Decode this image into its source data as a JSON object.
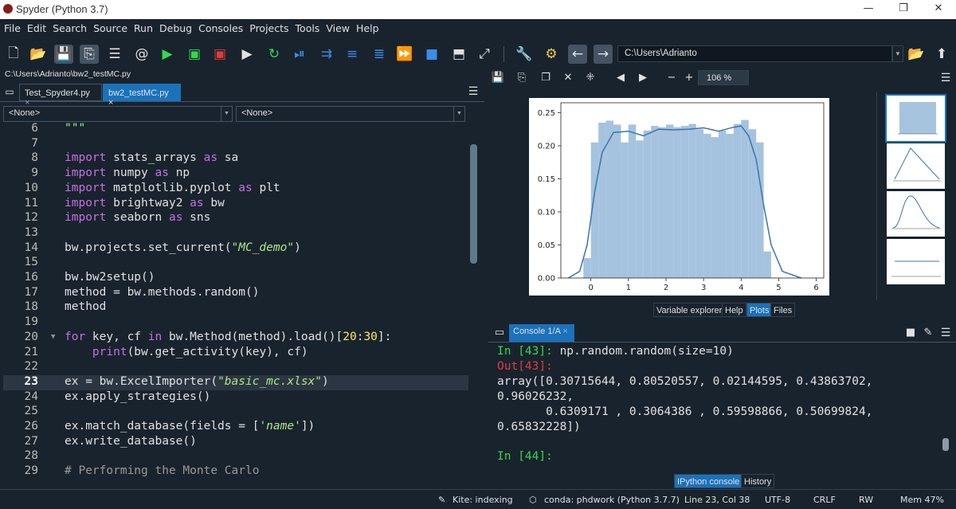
{
  "window": {
    "title": "Spyder (Python 3.7)",
    "minimize": "—",
    "maximize": "❐",
    "close": "✕"
  },
  "menu": [
    "File",
    "Edit",
    "Search",
    "Source",
    "Run",
    "Debug",
    "Consoles",
    "Projects",
    "Tools",
    "View",
    "Help"
  ],
  "toolbar": {
    "working_dir": "C:\\Users\\Adrianto"
  },
  "editor": {
    "file_path": "C:\\Users\\Adrianto\\bw2_testMC.py",
    "tabs": [
      {
        "label": "Test_Spyder4.py",
        "close": "×"
      },
      {
        "label": "bw2_testMC.py",
        "close": "×"
      }
    ],
    "class_combo": "<None>",
    "func_combo": "<None>",
    "current_line": "23"
  },
  "plots": {
    "zoom": "106 %",
    "yticks": [
      "0.25",
      "0.20",
      "0.15",
      "0.10",
      "0.05",
      "0.00"
    ],
    "xticks": [
      "0",
      "1",
      "2",
      "3",
      "4",
      "5",
      "6"
    ]
  },
  "chart_data": {
    "type": "bar",
    "title": "",
    "categories": [
      "-0.1",
      "0.1",
      "0.3",
      "0.5",
      "0.7",
      "0.9",
      "1.1",
      "1.3",
      "1.5",
      "1.7",
      "1.9",
      "2.1",
      "2.3",
      "2.5",
      "2.7",
      "2.9",
      "3.1",
      "3.3",
      "3.5",
      "3.7",
      "3.9",
      "4.1",
      "4.3",
      "4.5",
      "4.7"
    ],
    "values": [
      0.03,
      0.205,
      0.235,
      0.238,
      0.232,
      0.205,
      0.232,
      0.208,
      0.223,
      0.23,
      0.228,
      0.232,
      0.228,
      0.23,
      0.233,
      0.225,
      0.218,
      0.213,
      0.223,
      0.218,
      0.233,
      0.239,
      0.225,
      0.205,
      0.04
    ],
    "kde_x": [
      -0.6,
      -0.3,
      -0.1,
      0.1,
      0.3,
      0.6,
      1.0,
      1.4,
      1.8,
      2.2,
      2.6,
      3.0,
      3.4,
      3.8,
      4.0,
      4.2,
      4.4,
      4.6,
      4.8,
      5.1,
      5.6
    ],
    "kde_y": [
      0.0,
      0.01,
      0.05,
      0.13,
      0.19,
      0.22,
      0.222,
      0.215,
      0.225,
      0.224,
      0.225,
      0.227,
      0.222,
      0.228,
      0.23,
      0.215,
      0.18,
      0.11,
      0.05,
      0.01,
      0.0
    ],
    "xlim": [
      -0.8,
      6.2
    ],
    "ylim": [
      0,
      0.265
    ],
    "grid": false
  },
  "pane_tabs": [
    "Variable explorer",
    "Help",
    "Plots",
    "Files"
  ],
  "active_pane_tab": "Plots",
  "console": {
    "tab": "Console 1/A",
    "lines": [
      {
        "prompt": "In [43]: ",
        "text": "np.random.random(size=10)",
        "kind": "in"
      },
      {
        "prompt": "Out[43]:",
        "text": "",
        "kind": "out"
      },
      {
        "prompt": "",
        "text": "array([0.30715644, 0.80520557, 0.02144595, 0.43863702,",
        "kind": "plain"
      },
      {
        "prompt": "",
        "text": "0.96026232,",
        "kind": "plain"
      },
      {
        "prompt": "",
        "text": "       0.6309171 , 0.3064386 , 0.59598866, 0.50699824,",
        "kind": "plain"
      },
      {
        "prompt": "",
        "text": "0.65832228])",
        "kind": "plain"
      },
      {
        "prompt": "",
        "text": "",
        "kind": "plain"
      },
      {
        "prompt": "In [44]: ",
        "text": "",
        "kind": "in"
      }
    ]
  },
  "bottom_tabs": [
    "IPython console",
    "History"
  ],
  "status": {
    "kite": "Kite: indexing",
    "conda": "conda: phdwork (Python 3.7.7)",
    "position": "Line 23, Col 38",
    "encoding": "UTF-8",
    "eol": "CRLF",
    "perm": "RW",
    "mem": "Mem 47%"
  }
}
